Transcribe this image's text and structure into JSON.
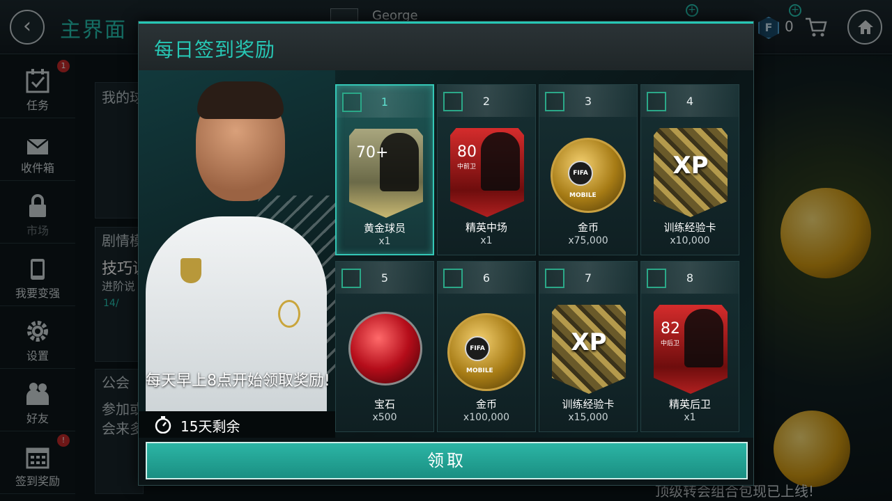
{
  "topbar": {
    "title": "主界面",
    "user_name": "George",
    "points": "0",
    "icons": {
      "back": "back-arrow-icon",
      "home": "home-icon",
      "cart": "cart-icon",
      "fifa_points": "fifa-points-icon"
    }
  },
  "sidebar": {
    "items": [
      {
        "label": "任务",
        "icon": "calendar-check-icon",
        "badge": "1"
      },
      {
        "label": "收件箱",
        "icon": "envelope-icon"
      },
      {
        "label": "市场",
        "icon": "lock-icon"
      },
      {
        "label": "我要变强",
        "icon": "phone-icon"
      },
      {
        "label": "设置",
        "icon": "gear-icon"
      },
      {
        "label": "好友",
        "icon": "friends-icon"
      },
      {
        "label": "签到奖励",
        "icon": "calendar-icon",
        "badge": "!"
      }
    ]
  },
  "background": {
    "panel1_title": "我的球",
    "panel2_title": "剧情模",
    "panel2_line1": "技巧说",
    "panel2_line2": "进阶说",
    "panel2_progress": "14/",
    "panel3_title": "公会",
    "panel3_line1": "参加或",
    "panel3_line2": "会来多",
    "news": "顶级转会组合包现已上线!"
  },
  "modal": {
    "title": "每日签到奖励",
    "hero_message": "每天早上8点开始领取奖励!",
    "timer_text": "15天剩余",
    "claim_label": "领取",
    "colors": {
      "accent": "#27c6b4",
      "button": "#2cb5a5"
    }
  },
  "rewards": [
    {
      "day": "1",
      "name": "黄金球员",
      "qty": "x1",
      "card": "gold",
      "rating": "70+"
    },
    {
      "day": "2",
      "name": "精英中场",
      "qty": "x1",
      "card": "red",
      "rating": "80",
      "position": "中前卫"
    },
    {
      "day": "3",
      "name": "金币",
      "qty": "x75,000",
      "card": "coins",
      "coin_text": "FIFA MOBILE"
    },
    {
      "day": "4",
      "name": "训练经验卡",
      "qty": "x10,000",
      "card": "xp",
      "xp_text": "XP"
    },
    {
      "day": "5",
      "name": "宝石",
      "qty": "x500",
      "card": "gem"
    },
    {
      "day": "6",
      "name": "金币",
      "qty": "x100,000",
      "card": "coins",
      "coin_text": "FIFA MOBILE"
    },
    {
      "day": "7",
      "name": "训练经验卡",
      "qty": "x15,000",
      "card": "xp",
      "xp_text": "XP"
    },
    {
      "day": "8",
      "name": "精英后卫",
      "qty": "x1",
      "card": "red",
      "rating": "82",
      "position": "中后卫"
    }
  ]
}
